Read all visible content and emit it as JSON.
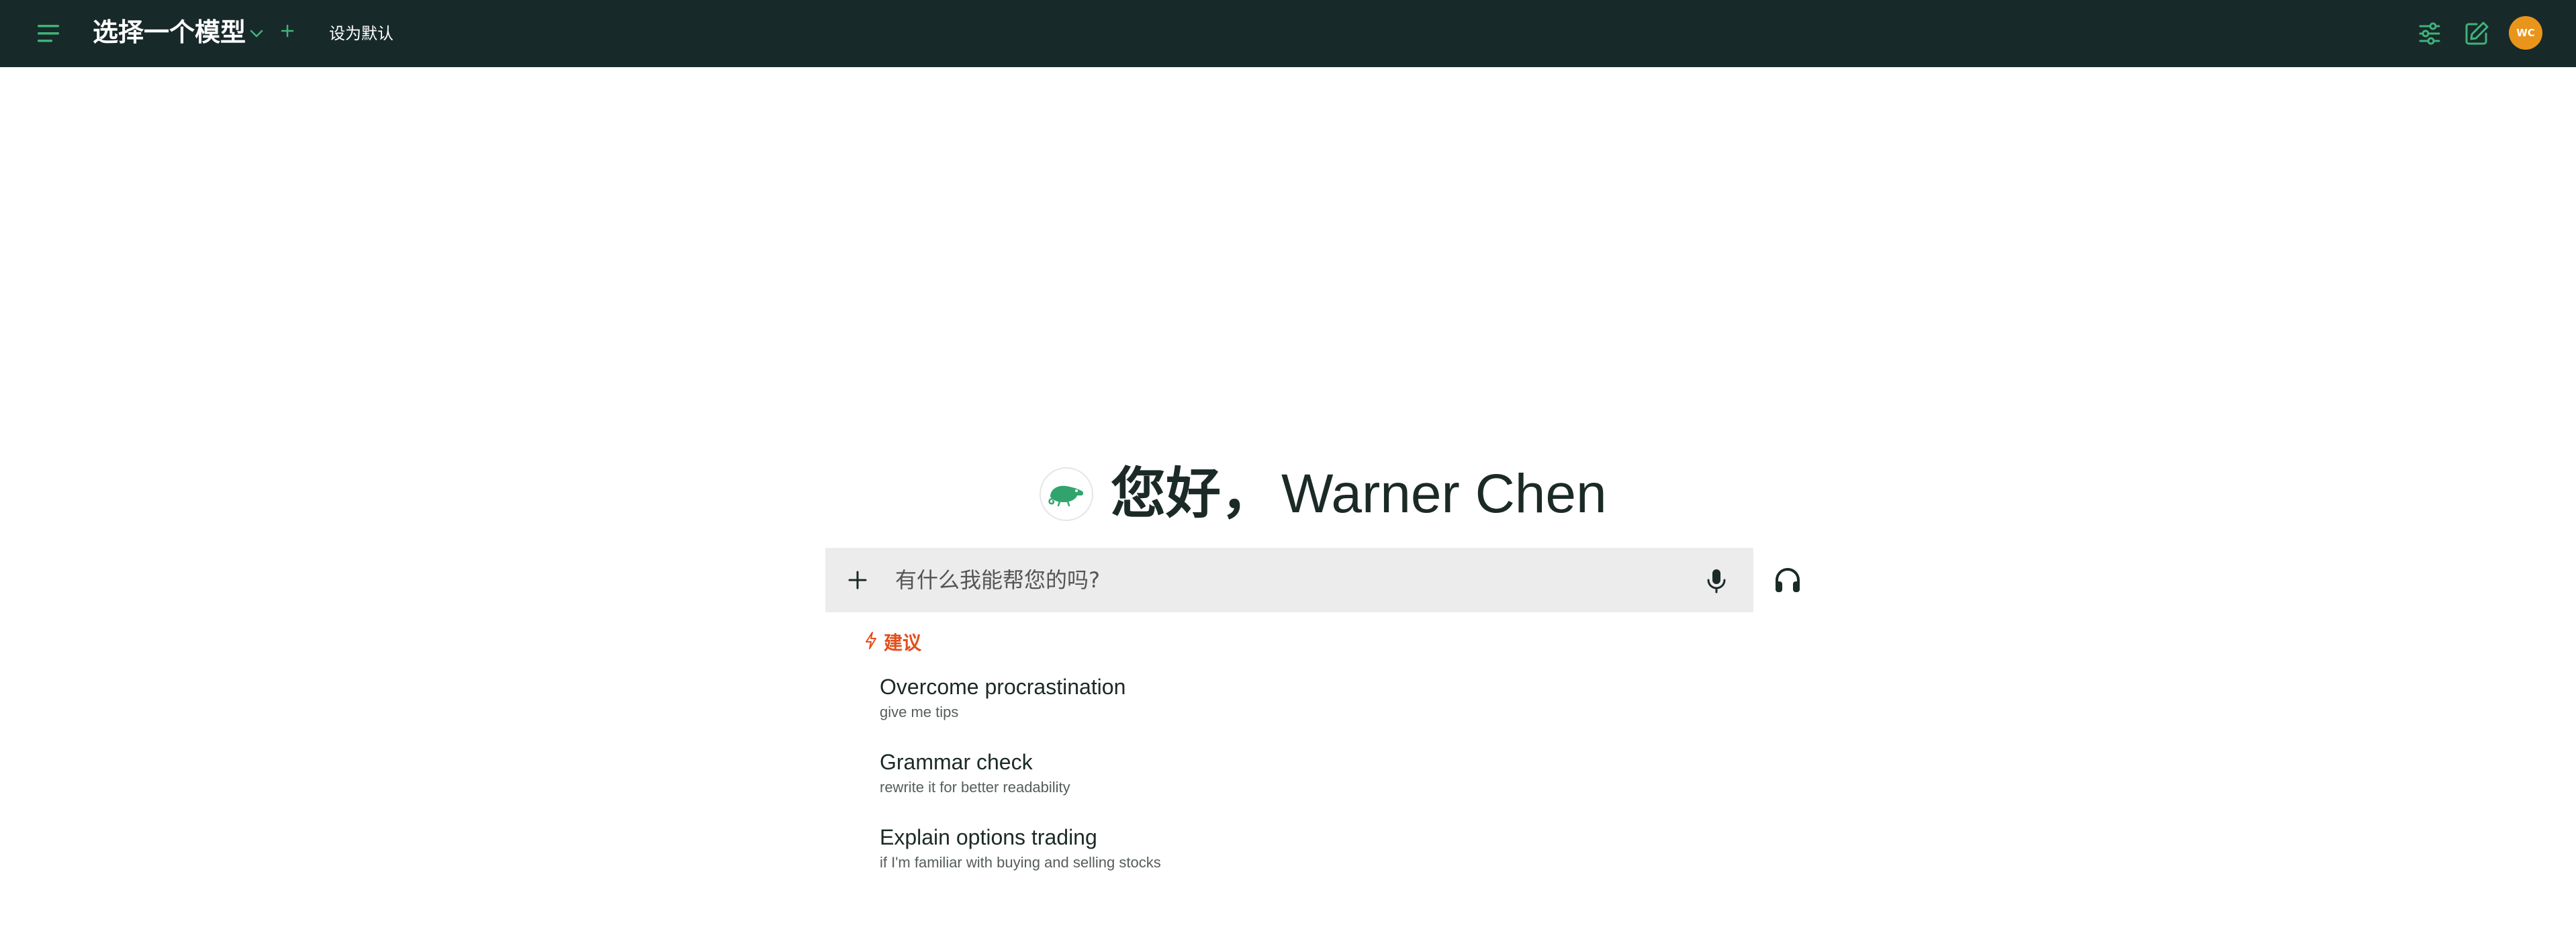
{
  "header": {
    "model_title": "选择一个模型",
    "set_default_label": "设为默认",
    "avatar_initials": "WC",
    "icons": [
      "menu-icon",
      "chevron-down-icon",
      "plus-icon",
      "sliders-icon",
      "edit-icon"
    ]
  },
  "main": {
    "greeting_prefix": "您好，",
    "user_name": "Warner Chen",
    "logo_icon": "chameleon-logo-icon"
  },
  "chat": {
    "placeholder": "有什么我能帮您的吗?",
    "value": "",
    "icons": [
      "plus-icon",
      "microphone-icon",
      "headphones-icon"
    ]
  },
  "suggestions": {
    "header": "建议",
    "header_icon": "lightning-icon",
    "items": [
      {
        "title": "Overcome procrastination",
        "subtitle": "give me tips"
      },
      {
        "title": "Grammar check",
        "subtitle": "rewrite it for better readability"
      },
      {
        "title": "Explain options trading",
        "subtitle": "if I'm familiar with buying and selling stocks"
      }
    ]
  },
  "colors": {
    "topbar_bg": "#18292a",
    "accent_green": "#30a46c",
    "suggest_orange": "#e24f1d",
    "avatar_bg": "#e9951b",
    "input_bg": "#ececec"
  }
}
